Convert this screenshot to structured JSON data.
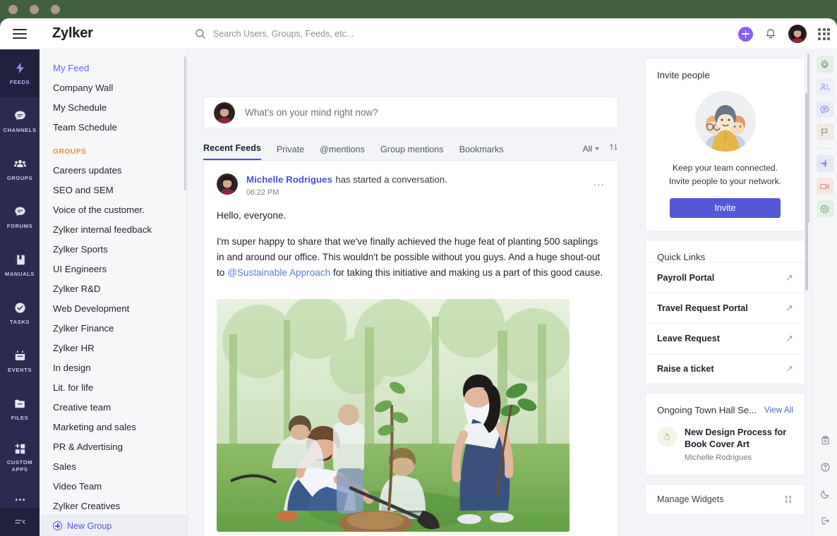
{
  "window": {
    "title": "Zylker"
  },
  "header": {
    "brand": "Zylker",
    "menu_label": "Menu",
    "search": {
      "placeholder": "Search Users, Groups, Feeds, etc...",
      "value": ""
    },
    "add_label": "Add",
    "notifications_label": "Notifications",
    "apps_label": "Apps",
    "avatar_label": "User profile"
  },
  "rail": {
    "items": [
      {
        "label": "FEEDS",
        "icon": "bolt-icon",
        "active": true
      },
      {
        "label": "CHANNELS",
        "icon": "chat-icon",
        "active": false
      },
      {
        "label": "GROUPS",
        "icon": "people-icon",
        "active": false
      },
      {
        "label": "FORUMS",
        "icon": "forum-icon",
        "active": false
      },
      {
        "label": "MANUALS",
        "icon": "book-icon",
        "active": false
      },
      {
        "label": "TASKS",
        "icon": "check-circle-icon",
        "active": false
      },
      {
        "label": "EVENTS",
        "icon": "calendar-icon",
        "active": false
      },
      {
        "label": "FILES",
        "icon": "folder-icon",
        "active": false
      },
      {
        "label": "CUSTOM APPS",
        "icon": "apps-plus-icon",
        "active": false
      },
      {
        "label": "MORE",
        "icon": "ellipsis-icon",
        "active": false
      }
    ],
    "collapse_label": "Collapse"
  },
  "sidebar": {
    "top_links": [
      {
        "label": "My Feed",
        "active": true
      },
      {
        "label": "Company Wall",
        "active": false
      },
      {
        "label": "My Schedule",
        "active": false
      },
      {
        "label": "Team Schedule",
        "active": false
      }
    ],
    "groups_heading": "GROUPS",
    "groups": [
      {
        "label": "Careers updates"
      },
      {
        "label": "SEO and SEM"
      },
      {
        "label": "Voice of the customer."
      },
      {
        "label": "Zylker internal feedback"
      },
      {
        "label": "Zylker Sports"
      },
      {
        "label": "UI Engineers"
      },
      {
        "label": "Zylker R&D"
      },
      {
        "label": "Web Development"
      },
      {
        "label": "Zylker Finance"
      },
      {
        "label": "Zylker HR"
      },
      {
        "label": "In design"
      },
      {
        "label": "Lit. for life"
      },
      {
        "label": "Creative team"
      },
      {
        "label": "Marketing and sales"
      },
      {
        "label": "PR & Advertising"
      },
      {
        "label": "Sales"
      },
      {
        "label": "Video Team"
      },
      {
        "label": "Zylker Creatives"
      }
    ],
    "new_group_label": "New Group"
  },
  "composer": {
    "placeholder": "What's on your mind right now?",
    "value": ""
  },
  "feed": {
    "tabs": [
      {
        "label": "Recent Feeds",
        "active": true
      },
      {
        "label": "Private",
        "active": false
      },
      {
        "label": "@mentions",
        "active": false
      },
      {
        "label": "Group mentions",
        "active": false
      },
      {
        "label": "Bookmarks",
        "active": false
      }
    ],
    "filter_label": "All",
    "sort_label": "Sort",
    "post": {
      "author": "Michelle Rodrigues",
      "action": "has started a conversation.",
      "time": "06:22 PM",
      "more_label": "...",
      "paragraph1": "Hello, everyone.",
      "paragraph2_part1": "I'm super happy to share that we've finally achieved the huge feat of planting 500 saplings in and around our office. This wouldn't be possible without you guys. And a huge shout-out to ",
      "paragraph2_mention": "@Sustainable Approach",
      "paragraph2_part2": " for taking this initiative and making us a part of this good cause.",
      "image_alt": "Volunteers planting trees in a park"
    }
  },
  "widgets": {
    "invite": {
      "title": "Invite people",
      "line1": "Keep your team connected.",
      "line2": "Invite people to your network.",
      "button": "Invite"
    },
    "quick_links": {
      "title": "Quick Links",
      "links": [
        {
          "label": "Payroll Portal"
        },
        {
          "label": "Travel Request Portal"
        },
        {
          "label": "Leave Request"
        },
        {
          "label": "Raise a ticket"
        }
      ]
    },
    "town_hall": {
      "title": "Ongoing Town Hall Se...",
      "view_all": "View All",
      "item_title": "New Design Process for Book Cover Art",
      "item_author": "Michelle Rodrigues"
    },
    "manage": {
      "label": "Manage Widgets"
    }
  },
  "right_rail": {
    "items": [
      {
        "icon": "gear-icon",
        "color": "#6f9f79",
        "bg": "#e4efe6"
      },
      {
        "icon": "contacts-icon",
        "color": "#8e95d4",
        "bg": "#eceef8"
      },
      {
        "icon": "chat-heart-icon",
        "color": "#7e8ad8",
        "bg": "#e9ebf8"
      },
      {
        "icon": "flag-icon",
        "color": "#9a8f7c",
        "bg": "#eeebe4"
      },
      {
        "icon": "puzzle-icon",
        "color": "#7b80cf",
        "bg": "#e8e9f7"
      },
      {
        "icon": "video-icon",
        "color": "#d08a82",
        "bg": "#f7e6e4"
      },
      {
        "icon": "camera-icon",
        "color": "#6f9f79",
        "bg": "#e4efe6"
      }
    ],
    "bottom_items": [
      {
        "icon": "clipboard-icon"
      },
      {
        "icon": "help-icon"
      },
      {
        "icon": "moon-icon"
      },
      {
        "icon": "logout-icon"
      }
    ]
  },
  "colors": {
    "accent": "#5558d6",
    "rail_bg": "#2b2b52",
    "groups_heading": "#e0913f",
    "os_bar": "#41603f",
    "add_button": "#8b5cf6"
  }
}
